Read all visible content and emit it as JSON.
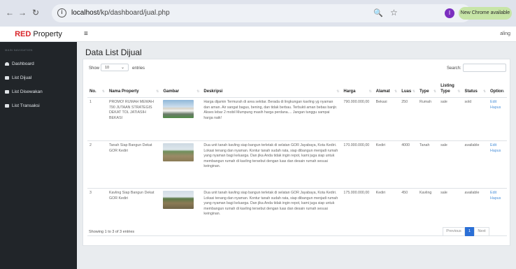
{
  "browser": {
    "url_host": "localhost",
    "url_path": "/kp/dashboard/jual.php",
    "new_chrome_label": "New Chrome available",
    "profile_initial": "I"
  },
  "topbar": {
    "brand_accent": "RED",
    "brand_rest": " Property",
    "user_label": "aling"
  },
  "sidebar": {
    "heading": "MAIN NAVIGATION",
    "items": [
      {
        "label": "Dashboard",
        "icon": "speedometer-icon"
      },
      {
        "label": "List Dijual",
        "icon": "table-icon"
      },
      {
        "label": "List Disewakan",
        "icon": "table-icon"
      },
      {
        "label": "List Transaksi",
        "icon": "table-icon"
      }
    ]
  },
  "main": {
    "title": "Data List Dijual",
    "show_label": "Show",
    "page_size": "10",
    "entries_label": "entries",
    "search_label": "Search:",
    "columns": [
      "No.",
      "Nama Property",
      "Gambar",
      "Deskripsi",
      "Harga",
      "Alamat",
      "Luas",
      "Type",
      "Listing Type",
      "Status",
      "Option"
    ],
    "rows": [
      {
        "no": "1",
        "nama": "PROMO! RUMAH MEWAH 790 JUTAAN STRATEGIS DEKAT TOL JATIASIH BEKASI",
        "image": "house-photo",
        "deskripsi": "Harga dijamin Termurah di area sekitar. Berada di lingkungan kavling yg nyaman dan aman. Air sangat bagus, bening, dan tidak berbau. Terbukti aman bebas banjir. Akses lebar 2 mobil Mumpung masih harga perdana.... Jangan tunggu sampai harga naik!",
        "harga": "790.000.000,00",
        "alamat": "Bekasi",
        "luas": "250",
        "type": "Rumah",
        "listing": "sale",
        "status": "sold",
        "edit": "Edit",
        "hapus": "Hapus"
      },
      {
        "no": "2",
        "nama": "Tanah Siap Bangun Dekat GOR Kediri",
        "image": "land-photo",
        "deskripsi": "Dua unit tanah kavling siap bangun terletak di selatan GOR Jayabaya, Kota Kediri. Lokasi tenang dan nyaman. Kontur tanah sudah rata, siap dibangun menjadi rumah yang nyaman bagi keluarga. Dan jika Anda tidak ingin repot, kami juga siap untuk membangun rumah di kavling tersebut dengan luas dan desain rumah sesuai keinginan.",
        "harga": "170.000.000,00",
        "alamat": "Kediri",
        "luas": "4000",
        "type": "Tanah",
        "listing": "sale",
        "status": "available",
        "edit": "Edit",
        "hapus": "Hapus"
      },
      {
        "no": "3",
        "nama": "Kavling Siap Bangun Dekat GOR Kediri",
        "image": "land-photo",
        "deskripsi": "Dua unit tanah kavling siap bangun terletak di selatan GOR Jayabaya, Kota Kediri. Lokasi tenang dan nyaman. Kontur tanah sudah rata, siap dibangun menjadi rumah yang nyaman bagi keluarga. Dan jika Anda tidak ingin repot, kami juga siap untuk membangun rumah di kavling tersebut dengan luas dan desain rumah sesuai keinginan.",
        "harga": "175.000.000,00",
        "alamat": "Kediri",
        "luas": "450",
        "type": "Kavling",
        "listing": "sale",
        "status": "available",
        "edit": "Edit",
        "hapus": "Hapus"
      }
    ],
    "info": "Showing 1 to 3 of 3 entries",
    "pagination": {
      "previous": "Previous",
      "current": "1",
      "next": "Next"
    }
  },
  "colors": {
    "brand_red": "#d9252a",
    "sidebar_bg": "#212529",
    "link": "#4a90d9",
    "pager_active": "#2b6fd6"
  }
}
